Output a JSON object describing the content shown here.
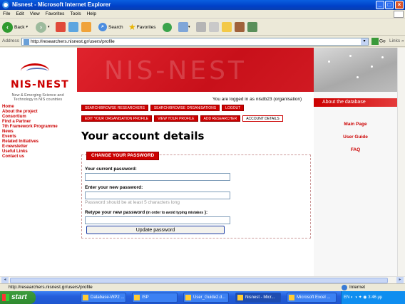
{
  "window": {
    "title": "Nisnest - Microsoft Internet Explorer"
  },
  "menu": [
    "File",
    "Edit",
    "View",
    "Favorites",
    "Tools",
    "Help"
  ],
  "toolbar": {
    "back_label": "Back",
    "search_label": "Search",
    "favorites_label": "Favorites"
  },
  "address": {
    "label": "Address",
    "url": "http://researchers.nisnest.gr/users/profile",
    "go_label": "Go",
    "links_label": "Links"
  },
  "status": {
    "url": "http://researchers.nisnest.gr/users/profile",
    "zone": "Internet"
  },
  "taskbar": {
    "start_label": "start",
    "tasks": [
      "Database-WP2 ...",
      "ISP",
      "User_Guide2.d...",
      "Nisnest - Micr...",
      "Microsoft Excel ..."
    ],
    "tray": "EN",
    "clock": "3:46 μμ"
  },
  "site": {
    "logo_text": "NIS-NEST",
    "logo_sub": "New & Emerging Science and Technology in NIS countries",
    "banner_text": "NIS-NEST",
    "nav": [
      "Home",
      "About the project",
      "Consortium",
      "Find a Partner",
      "7th Framework Programme",
      "News",
      "Events",
      "Related Initiatives",
      "E-newsletter",
      "Useful Links",
      "Contact us"
    ],
    "logged_in": "You are logged in as nisdb23 (organisation)",
    "row1": [
      "Search/Browse Researchers",
      "Search/Browse Organisations",
      "Logout"
    ],
    "row2": [
      "Edit your organisation profile",
      "View your profile",
      "Add researcher",
      "Account details"
    ],
    "heading": "Your account details",
    "tab_label": "CHANGE YOUR PASSWORD",
    "current_label": "Your current password:",
    "new_label": "Enter your new password:",
    "hint": "Password should be at least 5 characters long",
    "retype_label": "Retype your new password",
    "retype_note": "(in order to avoid typing mistakes",
    "retype_tail": "):",
    "submit_label": "Update password",
    "about_label": "About the database",
    "right_links": [
      "Main Page",
      "User Guide",
      "FAQ"
    ]
  }
}
